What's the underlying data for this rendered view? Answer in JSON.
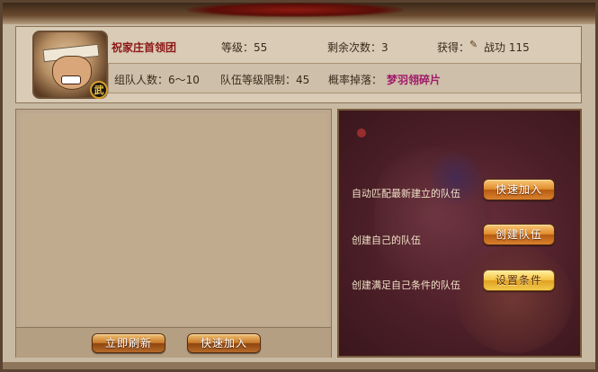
{
  "header": {
    "stage_name": "祝家庄首领团",
    "level_label": "等级：55",
    "remaining_label": "剩余次数：3",
    "reward_label": "获得：",
    "reward_icon": "scroll-icon",
    "reward_value": "战功 115",
    "class_badge": "武",
    "team_size": "组队人数：6～10",
    "level_limit": "队伍等级限制：45",
    "drop_label": "概率掉落：",
    "drop_value": "梦羽翎碎片"
  },
  "team_list": {
    "refresh_button": "立即刷新",
    "quick_join_button": "快速加入"
  },
  "actions": {
    "auto_match_text": "自动匹配最新建立的队伍",
    "quick_join_button": "快速加入",
    "create_team_text": "创建自己的队伍",
    "create_team_button": "创建队伍",
    "create_cond_text": "创建满足自己条件的队伍",
    "set_cond_button": "设置条件"
  }
}
